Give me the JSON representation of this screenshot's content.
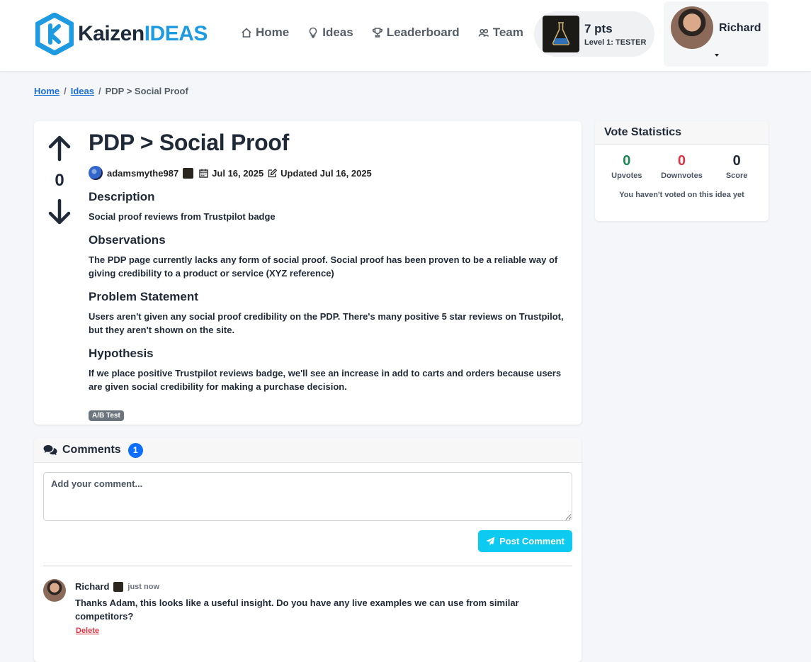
{
  "header": {
    "logo_main": "Kaizen",
    "logo_accent": "IDEAS",
    "nav": [
      {
        "label": "Home",
        "icon": "house-icon"
      },
      {
        "label": "Ideas",
        "icon": "lightbulb-icon"
      },
      {
        "label": "Leaderboard",
        "icon": "trophy-icon"
      },
      {
        "label": "Team",
        "icon": "people-icon"
      }
    ],
    "points": "7 pts",
    "level": "Level 1: TESTER",
    "user_name": "Richard"
  },
  "breadcrumb": {
    "home": "Home",
    "ideas": "Ideas",
    "sep": "/",
    "current": "PDP > Social Proof"
  },
  "idea": {
    "title": "PDP > Social Proof",
    "vote_count": "0",
    "author": "adamsmythe987",
    "date": "Jul 16, 2025",
    "updated": "Updated Jul 16, 2025",
    "sections": [
      {
        "heading": "Description",
        "text": "Social proof reviews from Trustpilot badge"
      },
      {
        "heading": "Observations",
        "text": "The PDP page currently lacks any form of social proof. Social proof has been proven to be a reliable way of giving credibility to a product or service (XYZ reference)"
      },
      {
        "heading": "Problem Statement",
        "text": "Users aren't given any social proof credibility on the PDP. There's many positive 5 star reviews on Trustpilot, but they aren't shown on the site."
      },
      {
        "heading": "Hypothesis",
        "text": "If we place positive Trustpilot reviews badge, we'll see an increase in add to carts and orders because users are given social credibility for making a purchase decision."
      }
    ],
    "tag": "A/B Test"
  },
  "vote_stats": {
    "title": "Vote Statistics",
    "upvotes": "0",
    "upvotes_label": "Upvotes",
    "downvotes": "0",
    "downvotes_label": "Downvotes",
    "score": "0",
    "score_label": "Score",
    "note": "You haven't voted on this idea yet"
  },
  "comments": {
    "title": "Comments",
    "count": "1",
    "placeholder": "Add your comment...",
    "post_label": "Post Comment",
    "items": [
      {
        "author": "Richard",
        "time": "just now",
        "text": "Thanks Adam, this looks like a useful insight. Do you have any live examples we can use from similar competitors?",
        "delete_label": "Delete"
      }
    ]
  },
  "colors": {
    "primary": "#0d6efd",
    "info": "#0dcaf0",
    "success": "#198754",
    "danger": "#dc3545",
    "logo_blue": "#1e9be0"
  }
}
